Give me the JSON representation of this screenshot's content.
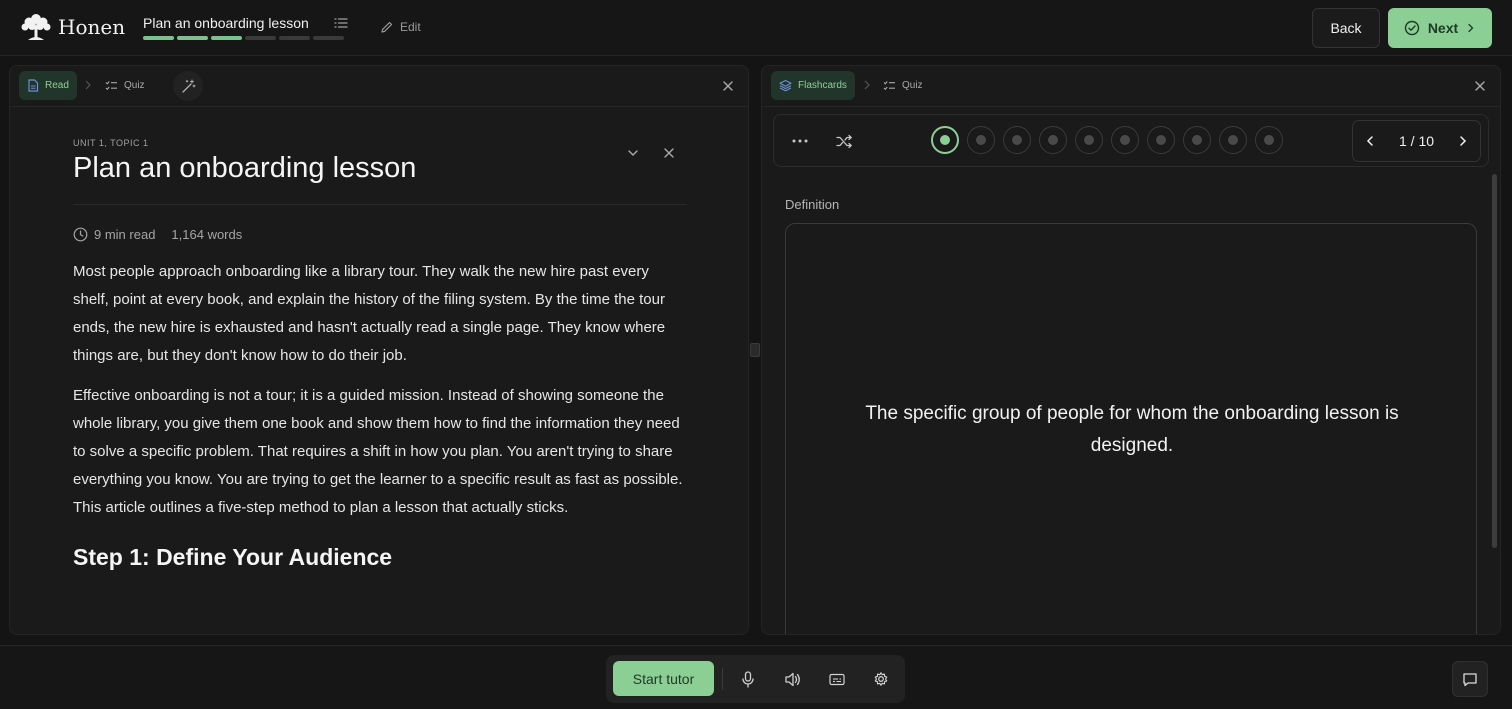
{
  "app": {
    "name": "Honen"
  },
  "header": {
    "lesson_title": "Plan an onboarding lesson",
    "progress": {
      "completed": 3,
      "total": 6
    },
    "edit_label": "Edit",
    "back_label": "Back",
    "next_label": "Next"
  },
  "left_panel": {
    "tabs": [
      {
        "label": "Read"
      },
      {
        "label": "Quiz"
      }
    ],
    "unit_label": "UNIT 1, TOPIC 1",
    "title": "Plan an onboarding lesson",
    "read_time": "9 min read",
    "word_count": "1,164 words",
    "paragraphs": [
      "Most people approach onboarding like a library tour. They walk the new hire past every shelf, point at every book, and explain the history of the filing system. By the time the tour ends, the new hire is exhausted and hasn't actually read a single page. They know where things are, but they don't know how to do their job.",
      "Effective onboarding is not a tour; it is a guided mission. Instead of showing someone the whole library, you give them one book and show them how to find the information they need to solve a specific problem. That requires a shift in how you plan. You aren't trying to share everything you know. You are trying to get the learner to a specific result as fast as possible. This article outlines a five-step method to plan a lesson that actually sticks."
    ],
    "section_heading": "Step 1: Define Your Audience"
  },
  "right_panel": {
    "tabs": [
      {
        "label": "Flashcards"
      },
      {
        "label": "Quiz"
      }
    ],
    "card_count": 10,
    "current_card": 1,
    "pager_text": "1 / 10",
    "side_label": "Definition",
    "card_text": "The specific group of people for whom the onboarding lesson is designed."
  },
  "bottom": {
    "start_tutor_label": "Start tutor"
  },
  "colors": {
    "accent": "#8bcf95",
    "background": "#141414",
    "panel": "#1a1a1a"
  }
}
